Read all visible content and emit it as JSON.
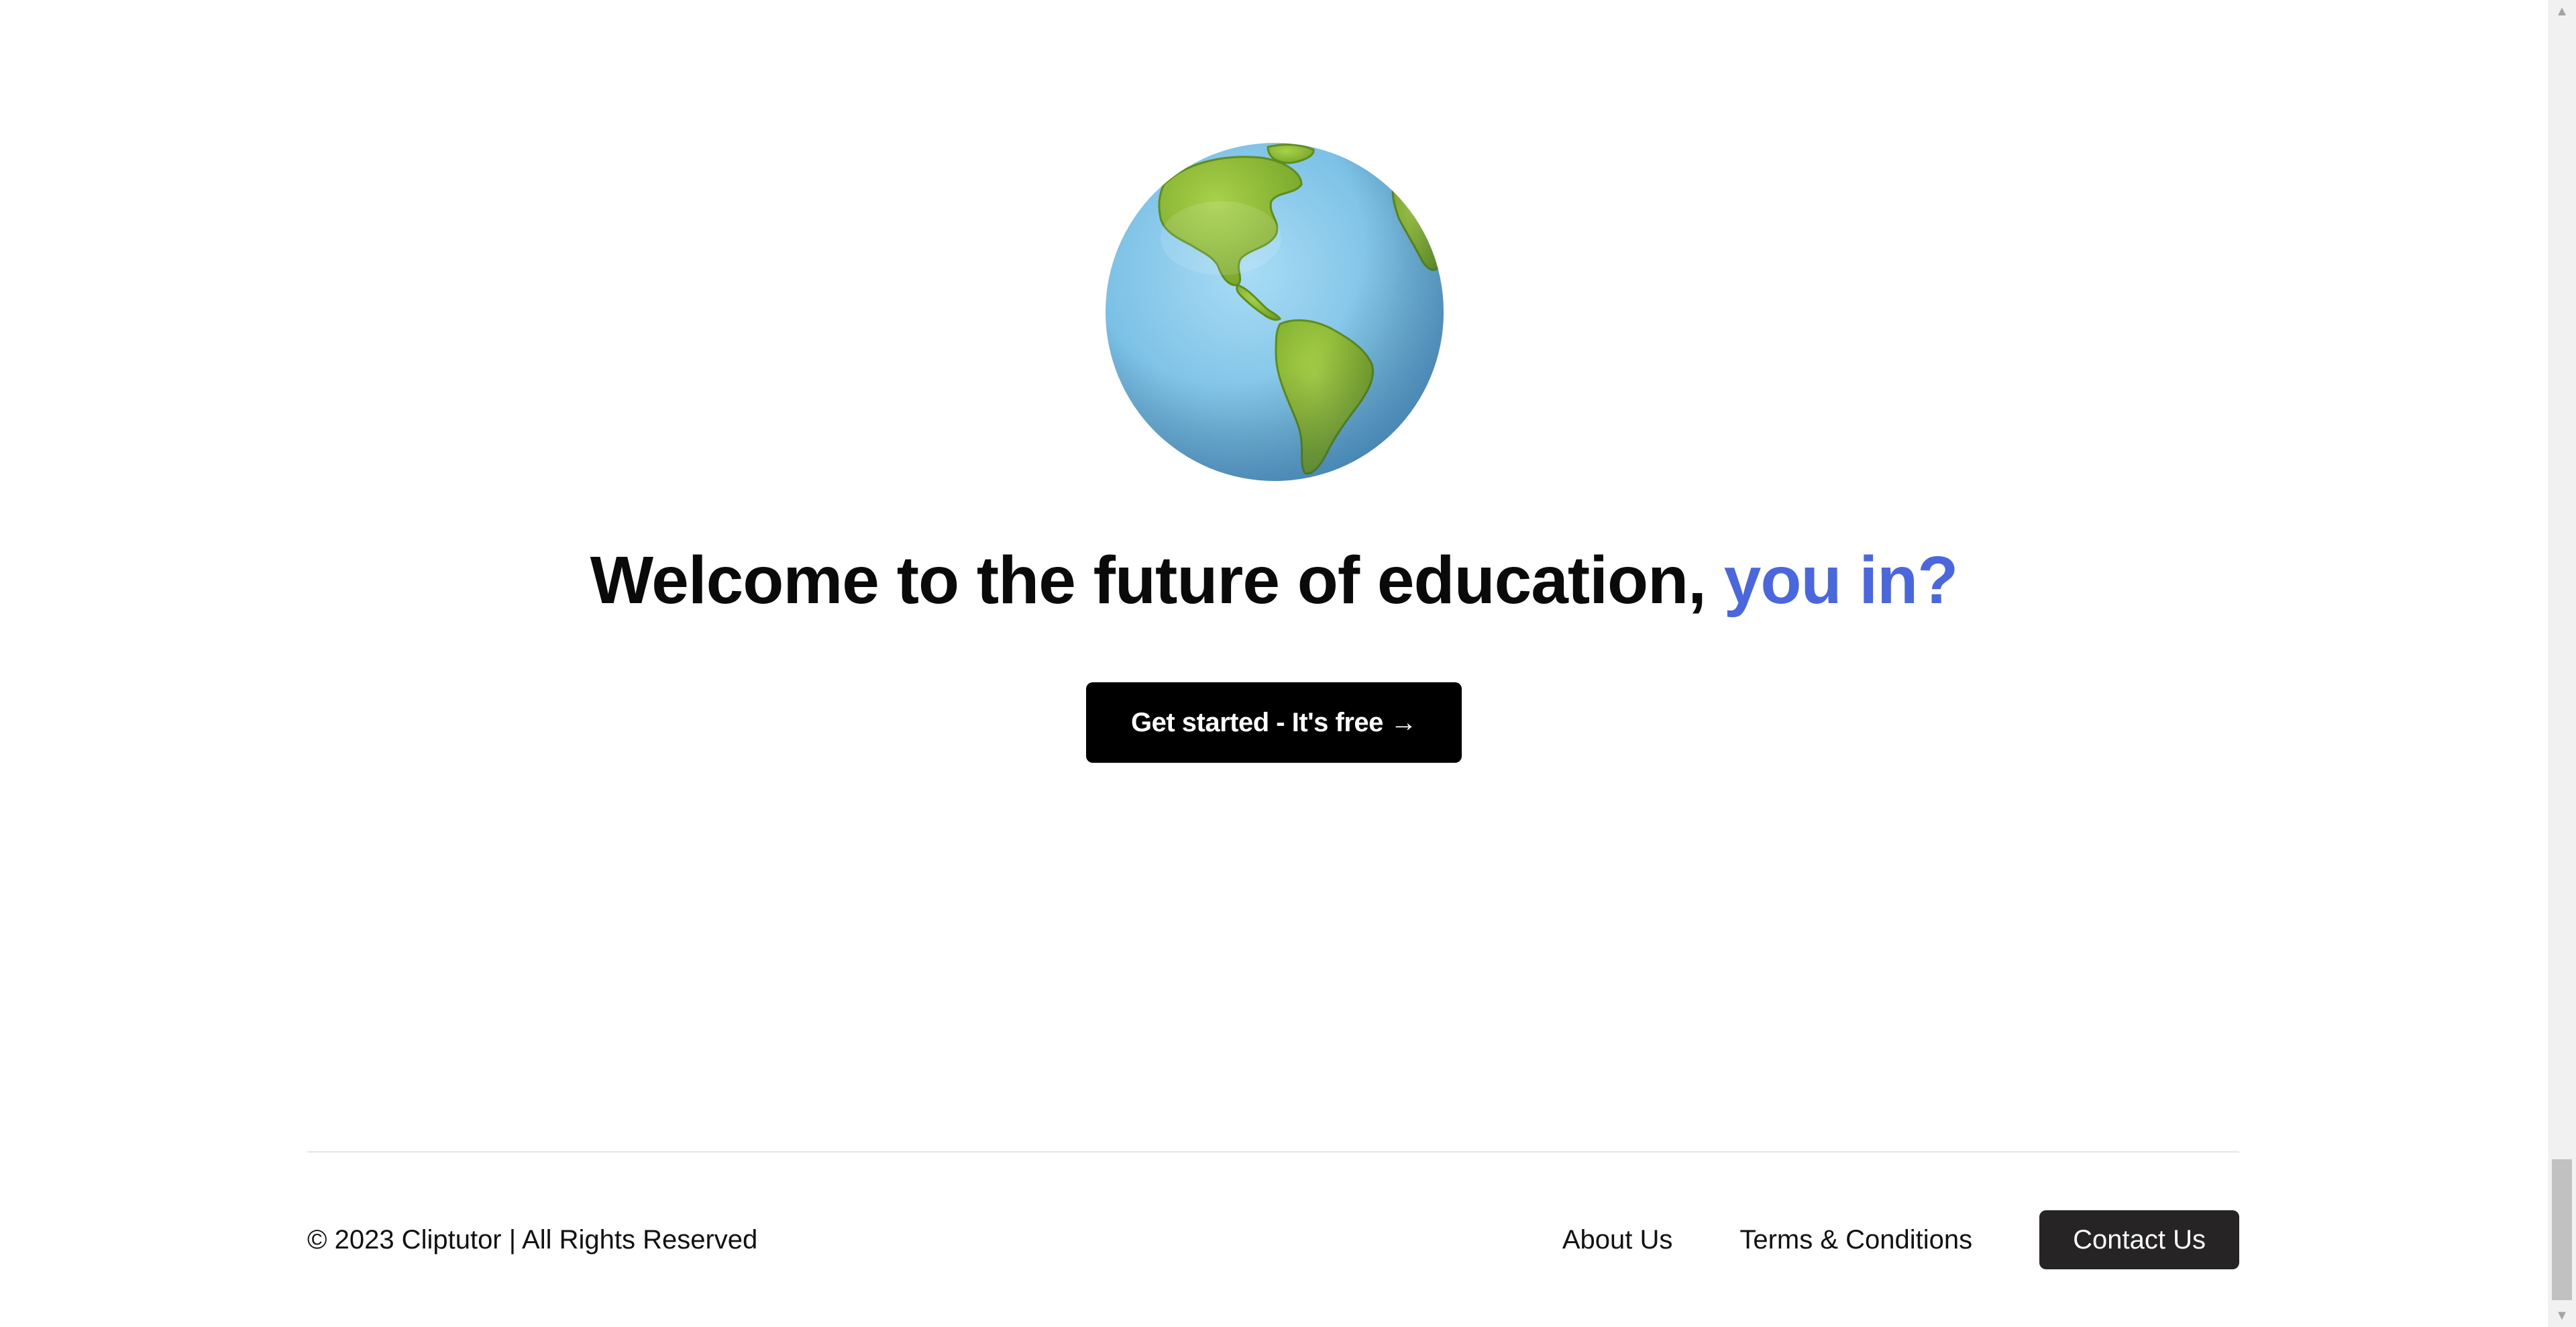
{
  "hero": {
    "headline_main": "Welcome to the future of education,",
    "headline_accent": "you in?",
    "cta_label": "Get started - It's free →",
    "accent_color": "#4a67dd",
    "globe_icon": "globe-icon"
  },
  "footer": {
    "copyright": "© 2023 Cliptutor | All Rights Reserved",
    "links": {
      "about": "About Us",
      "terms": "Terms & Conditions",
      "contact": "Contact Us"
    }
  },
  "scrollbar": {
    "up_arrow": "▲",
    "down_arrow": "▼"
  }
}
